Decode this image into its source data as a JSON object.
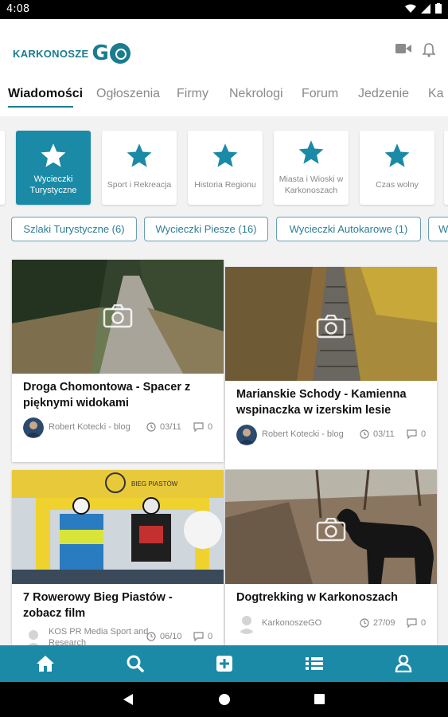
{
  "status_bar": {
    "time": "4:08"
  },
  "header": {
    "logo_text": "KARKONOSZE",
    "logo_go": "G"
  },
  "tabs": [
    {
      "label": "Wiadomości",
      "active": true
    },
    {
      "label": "Ogłoszenia"
    },
    {
      "label": "Firmy"
    },
    {
      "label": "Nekrologi"
    },
    {
      "label": "Forum"
    },
    {
      "label": "Jedzenie"
    },
    {
      "label": "Ka"
    }
  ],
  "categories": [
    {
      "label": "Wycieczki Turystyczne",
      "active": true
    },
    {
      "label": "Sport i Rekreacja"
    },
    {
      "label": "Historia Regionu"
    },
    {
      "label": "Miasta i Wioski w Karkonoszach"
    },
    {
      "label": "Czas wolny"
    }
  ],
  "chips": [
    "Szlaki Turystyczne (6)",
    "Wycieczki Piesze (16)",
    "Wycieczki Autokarowe (1)",
    "W"
  ],
  "articles": [
    {
      "title": "Droga Chomontowa - Spacer z pięknymi widokami",
      "author": "Robert Kotecki - blog",
      "date": "03/11",
      "comments": "0"
    },
    {
      "title": "Marianskie Schody - Kamienna wspinaczka w izerskim lesie",
      "author": "Robert Kotecki - blog",
      "date": "03/11",
      "comments": "0"
    },
    {
      "title": "7 Rowerowy Bieg Piastów - zobacz film",
      "author": "KOS PR Media Sport and Research",
      "date": "06/10",
      "comments": "0",
      "banner_text": "BIEG PIASTÓW"
    },
    {
      "title": "Dogtrekking w Karkonoszach",
      "author": "KarkonoszeGO",
      "date": "27/09",
      "comments": "0"
    }
  ],
  "colors": {
    "accent": "#1a8aa6",
    "brand": "#1a7c8e",
    "star": "#1a8aa6"
  }
}
